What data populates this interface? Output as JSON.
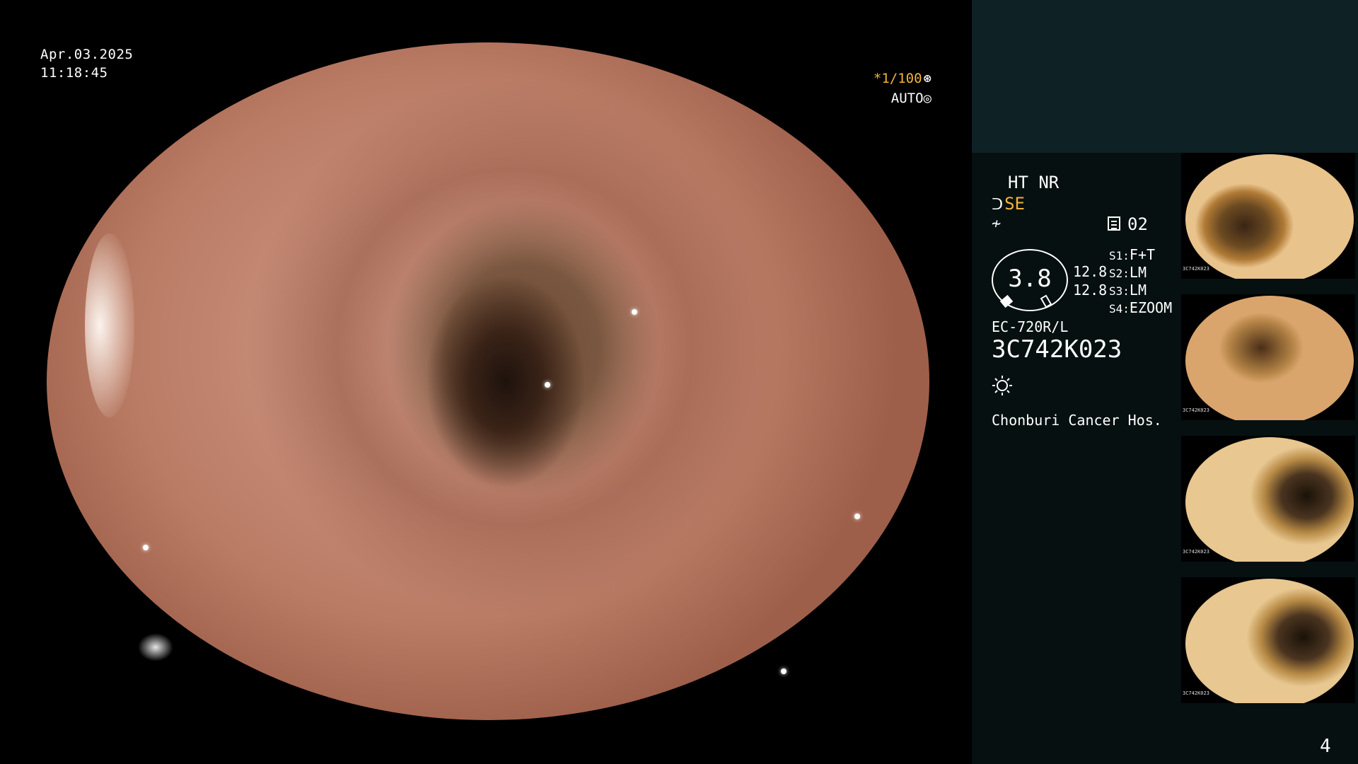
{
  "overlay": {
    "date": "Apr.03.2025",
    "time": "11:18:45",
    "shutter": "*1/100",
    "shutter_icon": "aperture-icon",
    "mode": "AUTO",
    "mode_icon": "iris-icon"
  },
  "panel": {
    "ht_nr": "HT NR",
    "se_label": "SE",
    "se_icon": "structure-enhance-icon",
    "filter_icon": "filter-icon",
    "doc_number": "02",
    "gauge_value": "3.8",
    "readout_1": "12.8",
    "readout_2": "12.8",
    "slots": [
      {
        "key": "S1:",
        "value": "F+T"
      },
      {
        "key": "S2:",
        "value": "LM"
      },
      {
        "key": "S3:",
        "value": "LM"
      },
      {
        "key": "S4:",
        "value": "EZOOM"
      }
    ],
    "model": "EC-720R/L",
    "serial": "3C742K023",
    "lamp_icon": "lamp-icon",
    "hospital": "Chonburi Cancer Hos."
  },
  "thumbnails": [
    {
      "name": "thumbnail-1",
      "serial": "3C742K023"
    },
    {
      "name": "thumbnail-2",
      "serial": "3C742K023"
    },
    {
      "name": "thumbnail-3",
      "serial": "3C742K023"
    },
    {
      "name": "thumbnail-4",
      "serial": "3C742K023"
    }
  ],
  "page_number": "4",
  "colors": {
    "accent_yellow": "#f2b53a",
    "panel_top": "#0e2124",
    "panel_bottom": "#061010"
  }
}
